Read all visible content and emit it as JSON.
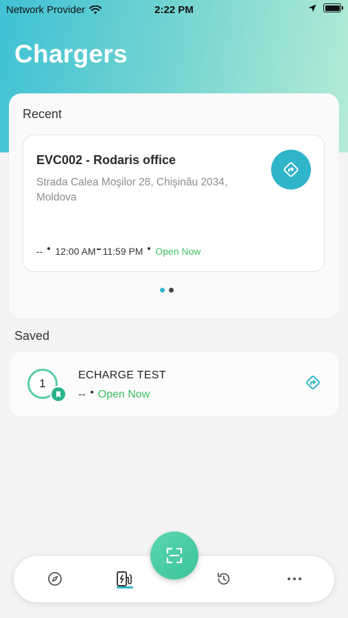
{
  "status_bar": {
    "carrier": "Network Provider",
    "time": "2:22 PM",
    "icons": [
      "wifi-icon",
      "location-arrow-icon",
      "battery-icon"
    ]
  },
  "page": {
    "title": "Chargers"
  },
  "recent": {
    "label": "Recent",
    "charger": {
      "title": "EVC002 - Rodaris office",
      "address": "Strada Calea Moşilor 28, Chişinău 2034, Moldova",
      "distance": "--",
      "hours_start": "12:00 AM",
      "hours_end": "11:59 PM",
      "status": "Open Now"
    },
    "pager": {
      "count": 2,
      "active_index": 0
    }
  },
  "saved": {
    "label": "Saved",
    "items": [
      {
        "count": "1",
        "name": "ECHARGE TEST",
        "distance": "--",
        "status": "Open Now"
      }
    ]
  },
  "nav": {
    "tabs": [
      "compass-icon",
      "charger-station-icon",
      "scan-icon",
      "history-icon",
      "more-icon"
    ],
    "active": "charger-station-icon"
  },
  "colors": {
    "accent": "#2fb4ca",
    "open_status": "#3cbf5e",
    "fab_green": "#4ccea6"
  }
}
